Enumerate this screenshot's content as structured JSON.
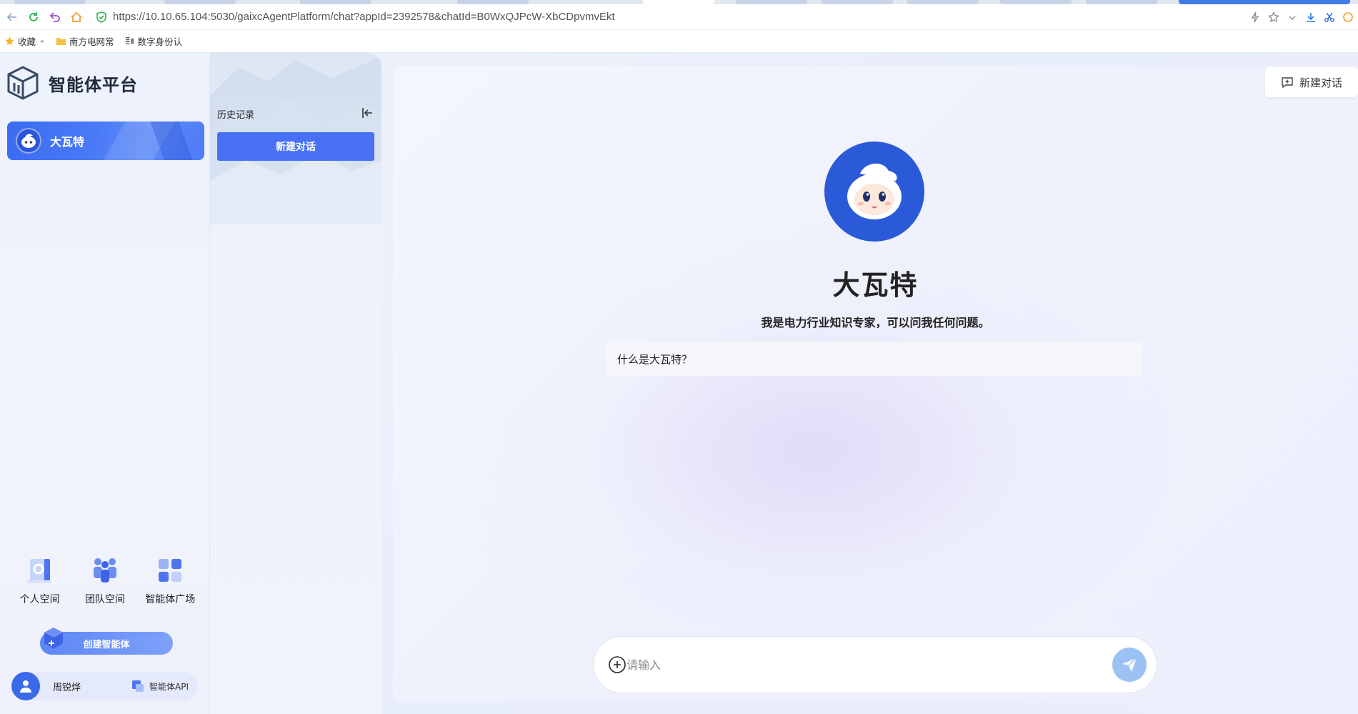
{
  "browser": {
    "url": "https://10.10.65.104:5030/gaixcAgentPlatform/chat?appId=2392578&chatId=B0WxQJPcW-XbCDpvmvEkt",
    "bookmarks": [
      {
        "label": "收藏",
        "icon": "star-icon"
      },
      {
        "label": "南方电网常",
        "icon": "folder-icon"
      },
      {
        "label": "数字身份认",
        "icon": "page-icon"
      }
    ]
  },
  "sidebar": {
    "brand_name": "智能体平台",
    "active_agent": "大瓦特",
    "spaces": [
      {
        "label": "个人空间",
        "icon": "personal-space-icon"
      },
      {
        "label": "团队空间",
        "icon": "team-space-icon"
      },
      {
        "label": "智能体广场",
        "icon": "agent-square-icon"
      }
    ],
    "create_label": "创建智能体",
    "user_name": "周锐烨",
    "api_label": "智能体API"
  },
  "history": {
    "title": "历史记录",
    "new_chat_label": "新建对话"
  },
  "main": {
    "top_new_chat_label": "新建对话",
    "agent_name": "大瓦特",
    "agent_desc": "我是电力行业知识专家，可以问我任何问题。",
    "suggestion": "什么是大瓦特？",
    "input_placeholder": "请输入"
  },
  "colors": {
    "accent": "#4770f5",
    "brand_dark": "#1f2a3a",
    "send_button": "#9cc2f3"
  }
}
